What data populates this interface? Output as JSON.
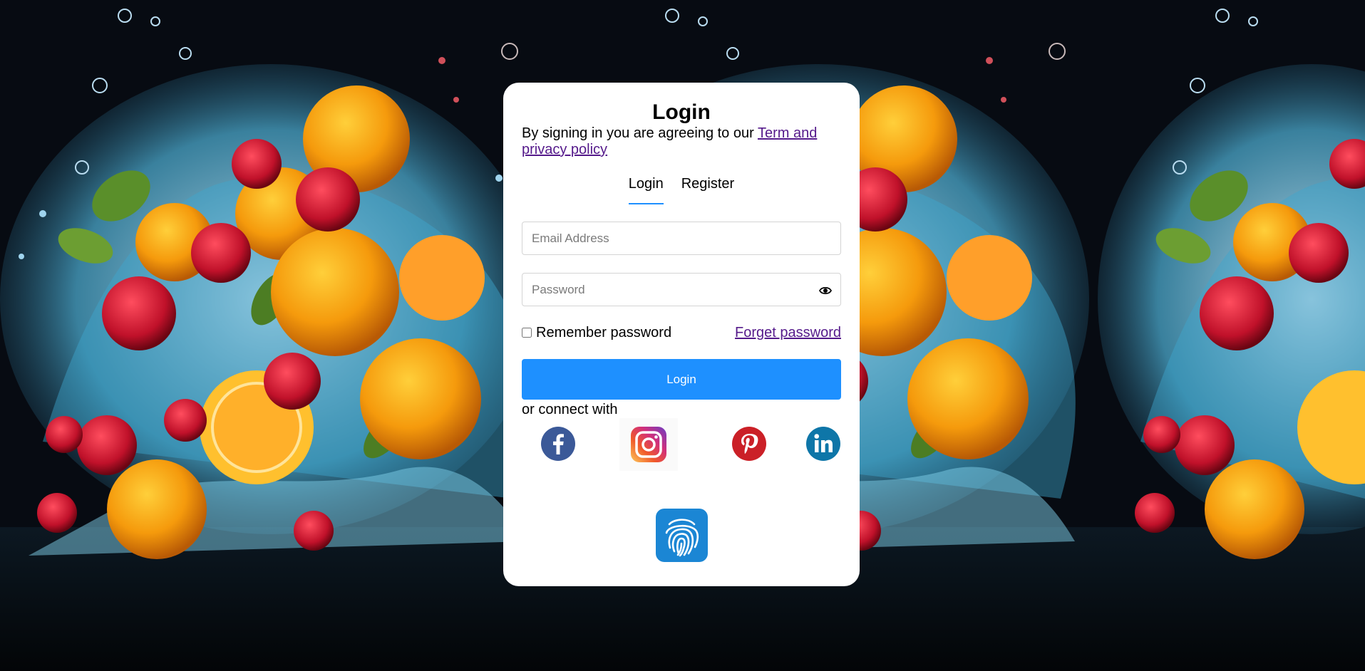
{
  "page": {
    "title": "Login",
    "agreement_text": "By signing in you are agreeing to our ",
    "agreement_link": "Term and privacy policy"
  },
  "tabs": [
    {
      "label": "Login",
      "active": true
    },
    {
      "label": "Register",
      "active": false
    }
  ],
  "form": {
    "email_placeholder": "Email Address",
    "email_value": "",
    "password_placeholder": "Password",
    "password_value": "",
    "remember_label": "Remember password",
    "remember_checked": false,
    "forget_label": "Forget password",
    "submit_label": "Login"
  },
  "social": {
    "label": "or connect with",
    "providers": [
      "facebook-icon",
      "instagram-icon",
      "pinterest-icon",
      "linkedin-icon"
    ]
  },
  "biometric": {
    "icon": "fingerprint-icon"
  },
  "colors": {
    "accent": "#1e90ff",
    "link": "#551a8b",
    "facebook": "#3b5998",
    "pinterest": "#cb2027",
    "linkedin": "#0e76a8",
    "fingerprint": "#1b86d4"
  }
}
